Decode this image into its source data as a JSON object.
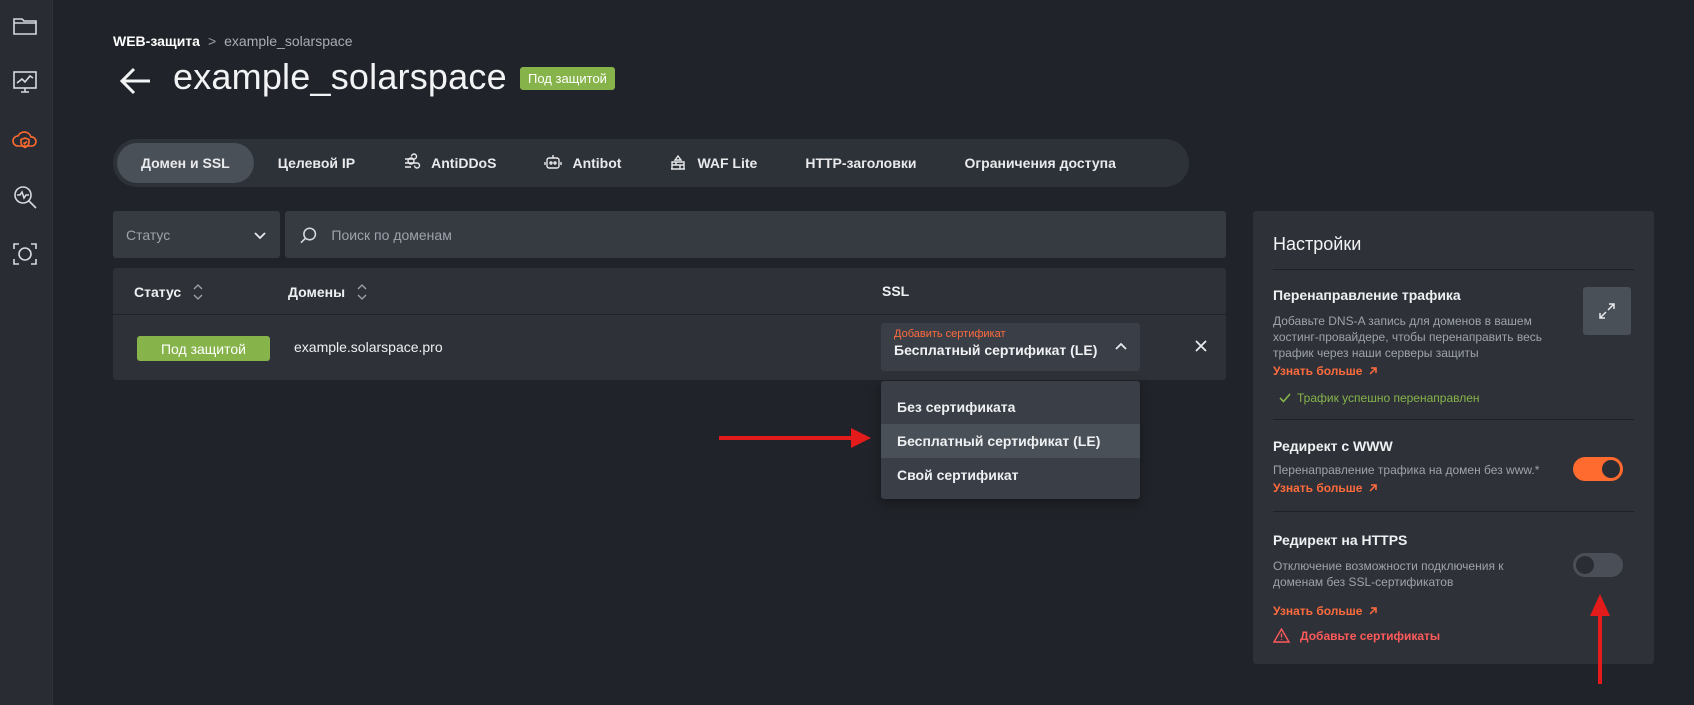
{
  "sidebar": {
    "items": [
      {
        "icon": "folder-icon"
      },
      {
        "icon": "monitor-chart-icon"
      },
      {
        "icon": "cloud-shield-icon",
        "active": true
      },
      {
        "icon": "search-pulse-icon"
      },
      {
        "icon": "scan-icon"
      }
    ],
    "accent": "#ff6a2f"
  },
  "breadcrumb": {
    "root": "WEB-защита",
    "separator": ">",
    "current": "example_solarspace"
  },
  "header": {
    "title": "example_solarspace",
    "badge": "Под защитой"
  },
  "tabs": [
    {
      "label": "Домен и SSL",
      "icon": "",
      "active": true
    },
    {
      "label": "Целевой IP",
      "icon": ""
    },
    {
      "label": "AntiDDoS",
      "icon": "wind-icon"
    },
    {
      "label": "Antibot",
      "icon": "robot-icon"
    },
    {
      "label": "WAF Lite",
      "icon": "firewall-icon"
    },
    {
      "label": "HTTP-заголовки",
      "icon": ""
    },
    {
      "label": "Ограничения доступа",
      "icon": ""
    }
  ],
  "filter": {
    "status_placeholder": "Статус",
    "search_placeholder": "Поиск по доменам"
  },
  "table": {
    "headers": {
      "status": "Статус",
      "domains": "Домены",
      "ssl": "SSL"
    },
    "rows": [
      {
        "status": "Под защитой",
        "domain": "example.solarspace.pro",
        "ssl_hint": "Добавить сертификат",
        "ssl_value": "Бесплатный сертификат (LE)"
      }
    ]
  },
  "ssl_dropdown": {
    "options": [
      "Без сертификата",
      "Бесплатный сертификат (LE)",
      "Свой сертификат"
    ],
    "highlighted": "Бесплатный сертификат (LE)"
  },
  "settings": {
    "title": "Настройки",
    "traffic": {
      "title": "Перенаправление трафика",
      "desc": [
        "Добавьте DNS-A запись для доменов в вашем",
        "хостинг-провайдере, чтобы перенаправить весь",
        "трафик через наши серверы защиты"
      ],
      "link": "Узнать больше",
      "ok": "Трафик успешно перенаправлен"
    },
    "www": {
      "title": "Редирект с WWW",
      "desc": "Перенаправление трафика на домен без www.*",
      "link": "Узнать больше",
      "enabled": true
    },
    "https": {
      "title": "Редирект на HTTPS",
      "desc": [
        "Отключение возможности подключения к",
        "доменам без SSL-сертификатов"
      ],
      "link": "Узнать больше",
      "warning": "Добавьте сертификаты",
      "enabled": false
    }
  },
  "colors": {
    "accent": "#ff6a2f",
    "success": "#86b34a",
    "warning": "#ff5a5a",
    "annotation": "#e31b1b"
  }
}
